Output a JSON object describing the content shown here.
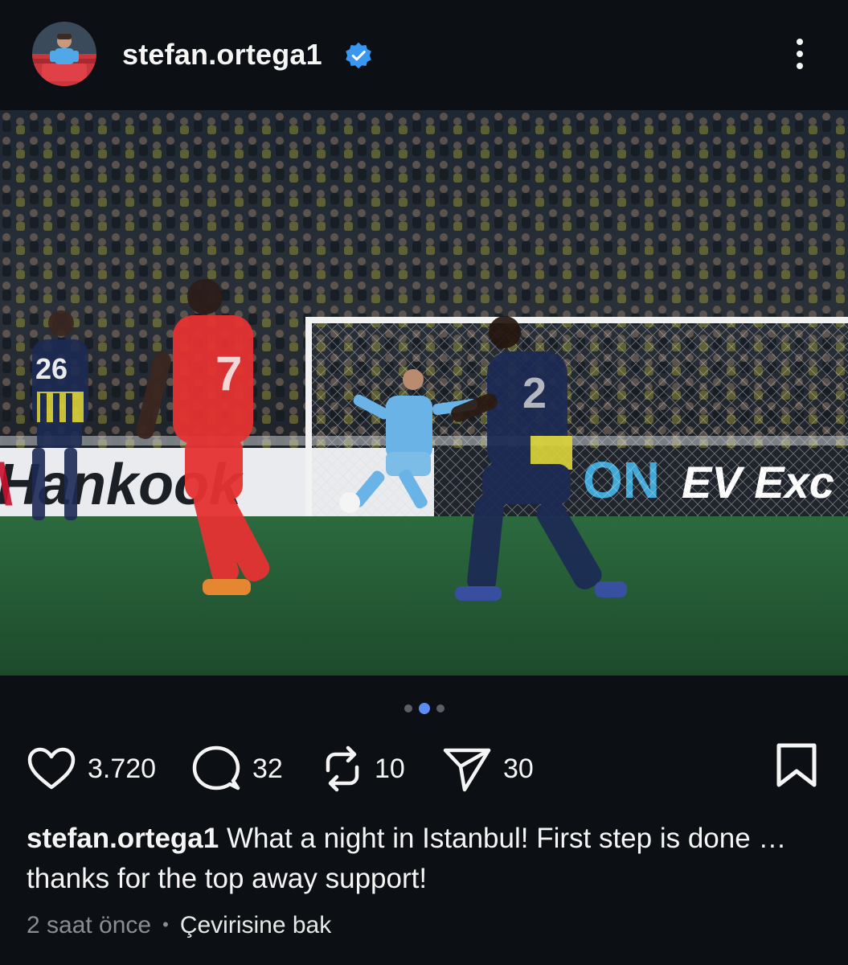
{
  "post": {
    "username": "stefan.ortega1",
    "verified_icon": "verified-badge-icon",
    "more_icon": "more-vertical-icon",
    "image": {
      "description_icon": "post-photo",
      "carousel_index": 2,
      "carousel_total": 3,
      "banner_texts": [
        "Hankook",
        "ON",
        "EV Exc"
      ],
      "jersey_numbers": [
        "26",
        "7",
        "2"
      ]
    },
    "actions": {
      "like_count": "3.720",
      "comment_count": "32",
      "repost_count": "10",
      "share_count": "30"
    },
    "caption": {
      "username": "stefan.ortega1",
      "text": " What a night in Istanbul! First step is done … thanks for the top away support!"
    },
    "meta": {
      "time": "2 saat önce",
      "separator": "•",
      "translate": "Çevirisine bak"
    }
  },
  "colors": {
    "background": "#0c0f14",
    "verified": "#3897f0",
    "active_dot": "#5c8df5",
    "inactive_dot": "#5b5f66",
    "muted_text": "#8a8d93"
  }
}
